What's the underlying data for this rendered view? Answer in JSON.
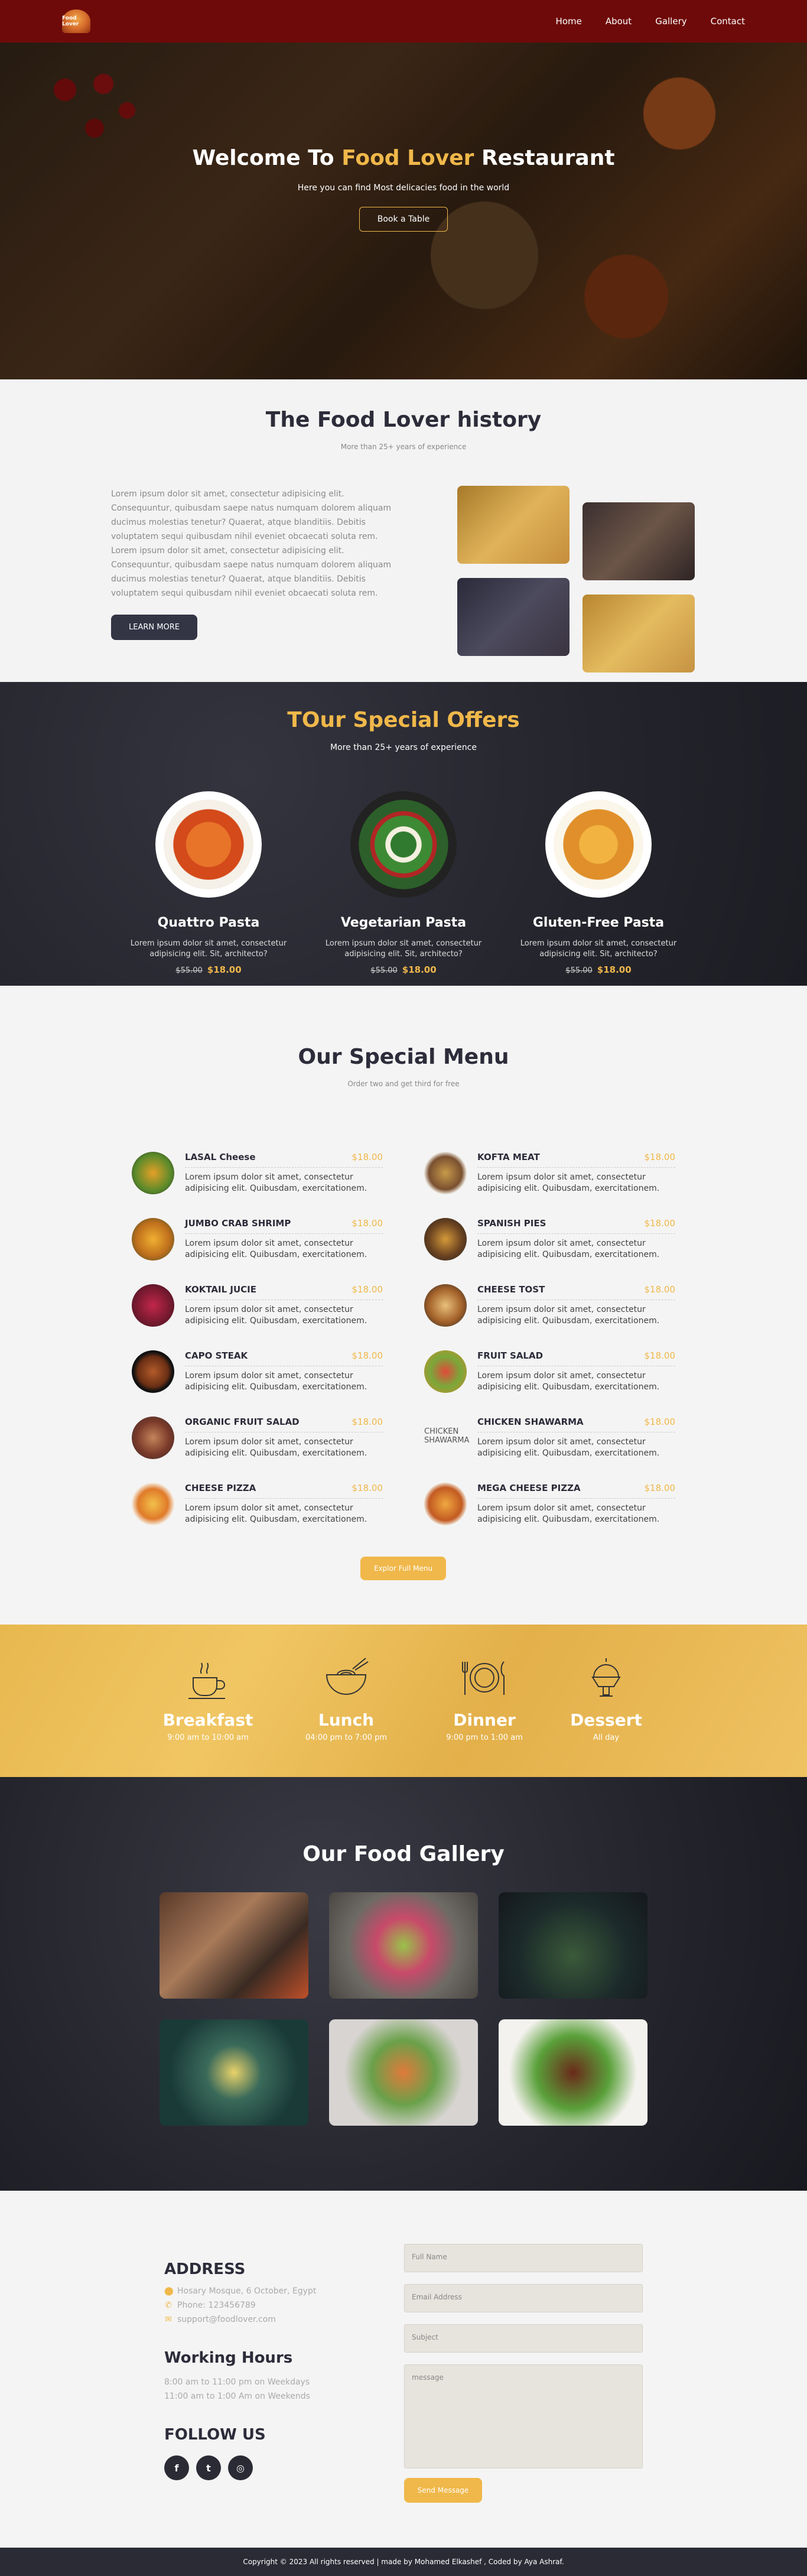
{
  "nav": {
    "logo_text": "Food Lover",
    "items": [
      "Home",
      "About",
      "Gallery",
      "Contact"
    ]
  },
  "hero": {
    "title_pre": "Welcome To ",
    "title_accent": "Food Lover",
    "title_post": " Restaurant",
    "subtitle": "Here you can find Most delicacies food in the world",
    "button": "Book a Table"
  },
  "history": {
    "title": "The Food Lover history",
    "subtitle": "More than 25+ years of experience",
    "text": "Lorem ipsum dolor sit amet, consectetur adipisicing elit. Consequuntur, quibusdam saepe natus numquam dolorem aliquam ducimus molestias tenetur? Quaerat, atque blanditiis. Debitis voluptatem sequi quibusdam nihil eveniet obcaecati soluta rem. Lorem ipsum dolor sit amet, consectetur adipisicing elit. Consequuntur, quibusdam saepe natus numquam dolorem aliquam ducimus molestias tenetur? Quaerat, atque blanditiis. Debitis voluptatem sequi quibusdam nihil eveniet obcaecati soluta rem.",
    "button": "LEARN MORE"
  },
  "offers": {
    "title": "TOur Special Offers",
    "subtitle": "More than 25+ years of experience",
    "items": [
      {
        "name": "Quattro Pasta",
        "desc": "Lorem ipsum dolor sit amet, consectetur adipisicing elit. Sit, architecto?",
        "old": "$55.00",
        "price": "$18.00"
      },
      {
        "name": "Vegetarian Pasta",
        "desc": "Lorem ipsum dolor sit amet, consectetur adipisicing elit. Sit, architecto?",
        "old": "$55.00",
        "price": "$18.00"
      },
      {
        "name": "Gluten-Free Pasta",
        "desc": "Lorem ipsum dolor sit amet, consectetur adipisicing elit. Sit, architecto?",
        "old": "$55.00",
        "price": "$18.00"
      }
    ]
  },
  "menu": {
    "title": "Our Special Menu",
    "subtitle": "Order two and get third for free",
    "desc": "Lorem ipsum dolor sit amet, consectetur adipisicing elit. Quibusdam, exercitationem.",
    "items": [
      {
        "name": "LASAL Cheese",
        "price": "$18.00"
      },
      {
        "name": "KOFTA MEAT",
        "price": "$18.00"
      },
      {
        "name": "JUMBO CRAB SHRIMP",
        "price": "$18.00"
      },
      {
        "name": "SPANISH PIES",
        "price": "$18.00"
      },
      {
        "name": "KOKTAIL JUCIE",
        "price": "$18.00"
      },
      {
        "name": "CHEESE TOST",
        "price": "$18.00"
      },
      {
        "name": "CAPO STEAK",
        "price": "$18.00"
      },
      {
        "name": "FRUIT SALAD",
        "price": "$18.00"
      },
      {
        "name": "ORGANIC FRUIT SALAD",
        "price": "$18.00"
      },
      {
        "name": "CHICKEN SHAWARMA",
        "price": "$18.00"
      },
      {
        "name": "CHEESE PIZZA",
        "price": "$18.00"
      },
      {
        "name": "MEGA CHEESE PIZZA",
        "price": "$18.00"
      }
    ],
    "broken_image_alt": "CHICKEN SHAWARMA",
    "button": "Explor Full Menu"
  },
  "hours": [
    {
      "title": "Breakfast",
      "time": "9:00 am to 10:00 am",
      "icon": "coffee-cup-icon"
    },
    {
      "title": "Lunch",
      "time": "04:00 pm to 7:00 pm",
      "icon": "noodle-bowl-icon"
    },
    {
      "title": "Dinner",
      "time": "9:00 pm to 1:00 am",
      "icon": "plate-cutlery-icon"
    },
    {
      "title": "Dessert",
      "time": "All day",
      "icon": "ice-cream-icon"
    }
  ],
  "gallery": {
    "title": "Our Food Gallery"
  },
  "contact": {
    "address_title": "ADDRESS",
    "address": "Hosary Mosque, 6 October, Egypt",
    "phone": "Phone: 123456789",
    "email": "support@foodlover.com",
    "hours_title": "Working Hours",
    "weekdays": "8:00 am to 11:00 pm on Weekdays",
    "weekends": "11:00 am to 1:00 Am on Weekends",
    "follow_title": "FOLLOW US",
    "form": {
      "name": "Full Name",
      "email": "Email Address",
      "subject": "Subject",
      "message": "message",
      "button": "Send Message"
    }
  },
  "footer": "Copyright © 2023 All rights reserved | made by Mohamed Elkashef , Coded by Aya Ashraf."
}
